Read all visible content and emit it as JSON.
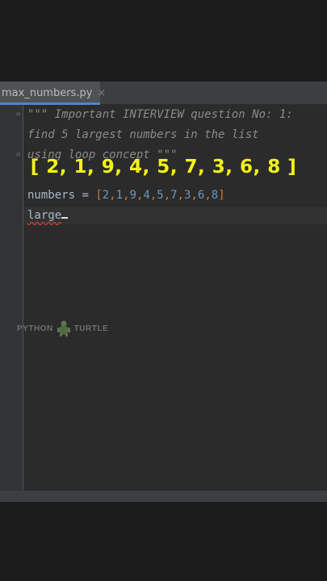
{
  "tab": {
    "label": "max_numbers.py",
    "close_glyph": "×"
  },
  "code": {
    "line1": "\"\"\" Important INTERVIEW question No: 1:",
    "line2": "find 5 largest numbers in the list",
    "line3": "using loop concept \"\"\"",
    "line5": {
      "name": "numbers",
      "eq": " = ",
      "open": "[",
      "items": [
        "2",
        ",",
        "1",
        ",",
        "9",
        ",",
        "4",
        ",",
        "5",
        ",",
        "7",
        ",",
        "3",
        ",",
        "6",
        ",",
        "8"
      ],
      "close": "]"
    },
    "line6": "large"
  },
  "overlay_text": "[ 2, 1, 9, 4, 5, 7, 3, 6, 8 ]",
  "watermark": {
    "left": "PYTHON",
    "right": "TURTLE"
  },
  "colors": {
    "overlay": "#f3f31a",
    "tab_underline": "#4a88c7",
    "comment": "#8a8a8a",
    "number": "#6897bb"
  }
}
